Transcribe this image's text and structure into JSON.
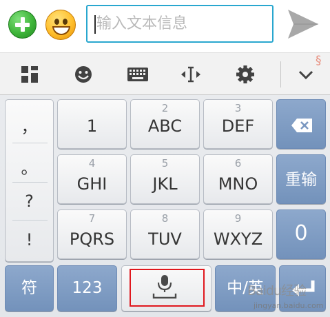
{
  "compose": {
    "add_icon": "plus-circle-icon",
    "emoji_icon": "smiley-face-icon",
    "input_placeholder": "输入文本信息",
    "send_icon": "send-arrow-icon"
  },
  "toolbar": {
    "icons": [
      "grid-icon",
      "emoji-icon",
      "keyboard-icon",
      "cursor-icon",
      "gear-icon",
      "chevron-down-icon"
    ]
  },
  "keyboard": {
    "punctuation": [
      "，",
      "。",
      "?",
      "!"
    ],
    "row1": [
      {
        "sub": "",
        "main": "1"
      },
      {
        "sub": "2",
        "main": "ABC"
      },
      {
        "sub": "3",
        "main": "DEF"
      }
    ],
    "row2": [
      {
        "sub": "4",
        "main": "GHI"
      },
      {
        "sub": "5",
        "main": "JKL"
      },
      {
        "sub": "6",
        "main": "MNO"
      }
    ],
    "row3": [
      {
        "sub": "7",
        "main": "PQRS"
      },
      {
        "sub": "8",
        "main": "TUV"
      },
      {
        "sub": "9",
        "main": "WXYZ"
      }
    ],
    "backspace_icon": "backspace-icon",
    "reenter_label": "重输",
    "zero_label": "0",
    "symbols_label": "符",
    "numbers_label": "123",
    "mic_icon": "microphone-icon",
    "lang_label": "中/英",
    "enter_icon": "enter-icon"
  },
  "watermark": {
    "main": "Baidu经验",
    "url": "jingyan.baidu.com"
  },
  "colors": {
    "input_border": "#29a7cf",
    "function_key": "#7f9dc4",
    "highlight_box": "#e0181e"
  }
}
